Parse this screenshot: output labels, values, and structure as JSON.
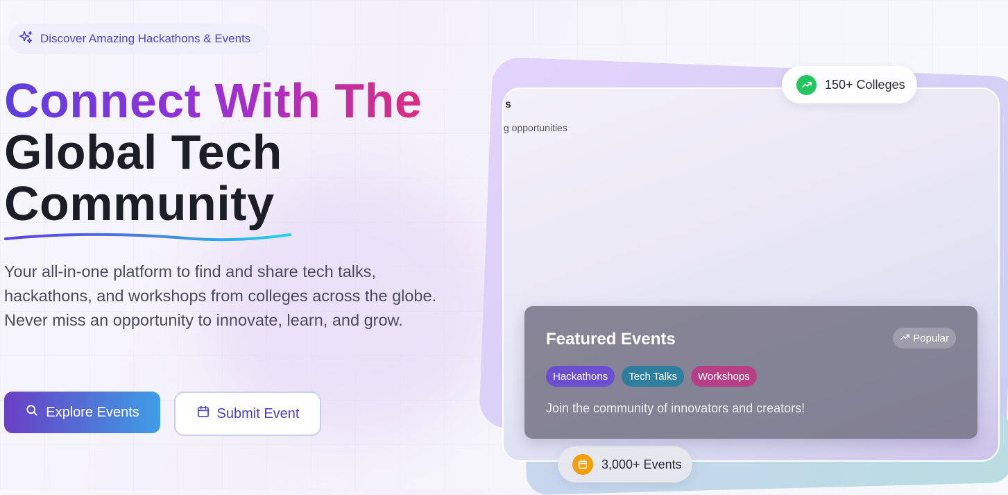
{
  "hero": {
    "badge_text": "Discover Amazing Hackathons & Events",
    "headline_line1": "Connect With The",
    "headline_line2": "Global Tech",
    "headline_line3": "Community",
    "description": "Your all-in-one platform to find and share tech talks, hackathons, and workshops from colleges across the globe. Never miss an opportunity to innovate, learn, and grow.",
    "primary_button": "Explore Events",
    "secondary_button": "Submit Event"
  },
  "showcase": {
    "peek_title": "s",
    "peek_subtitle": "g opportunities",
    "stat_top": "150+ Colleges",
    "stat_bottom": "3,000+ Events",
    "featured": {
      "title": "Featured Events",
      "badge": "Popular",
      "tags": [
        {
          "label": "Hackathons",
          "color": "#6a4fd1"
        },
        {
          "label": "Tech Talks",
          "color": "#2e7f9e"
        },
        {
          "label": "Workshops",
          "color": "#b63f86"
        }
      ],
      "subtitle": "Join the community of innovators and creators!"
    }
  },
  "icons": {
    "badge": "sparkles-icon",
    "primary_button": "search-icon",
    "secondary_button": "calendar-icon",
    "stat_top": "trending-up-icon",
    "stat_bottom": "calendar-icon",
    "featured_badge": "trending-up-icon"
  },
  "colors": {
    "accent_purple": "#5b3fe0",
    "accent_pink": "#dc2d7f",
    "accent_blue": "#3f9de6",
    "success": "#22c55e",
    "warning": "#f59e0b"
  }
}
